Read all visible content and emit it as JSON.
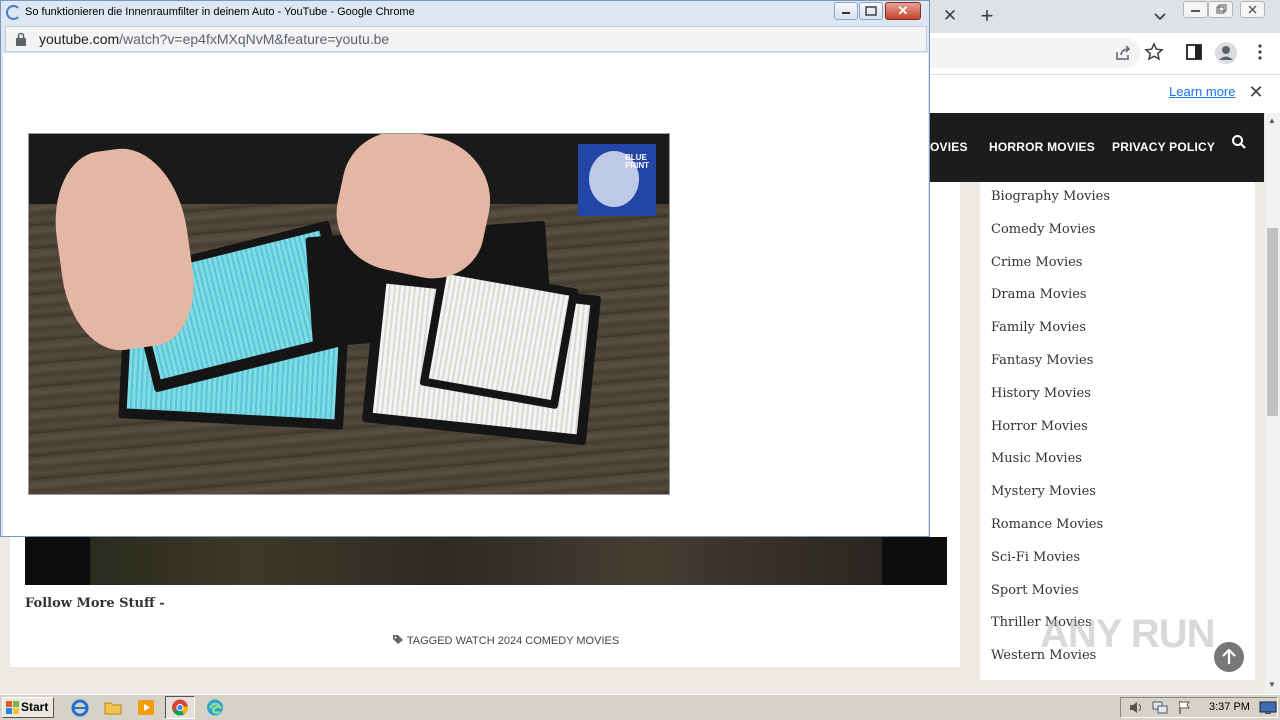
{
  "popup": {
    "title": "So funktionieren die Innenraumfilter in deinem Auto - YouTube - Google Chrome",
    "url_host": "youtube.com",
    "url_path": "/watch?v=ep4fxMXqNvM&feature=youtu.be",
    "video_logo_text": "BLUE PRINT"
  },
  "browser": {
    "infobar_link": "Learn more"
  },
  "site": {
    "nav": [
      "OVIES",
      "HORROR MOVIES",
      "PRIVACY POLICY"
    ],
    "follow_text": "Follow More Stuff -",
    "tagged_prefix": "TAGGED",
    "tagged_link": "WATCH 2024 COMEDY MOVIES",
    "sidebar_categories": [
      "Biography Movies",
      "Comedy Movies",
      "Crime Movies",
      "Drama Movies",
      "Family Movies",
      "Fantasy Movies",
      "History Movies",
      "Horror Movies",
      "Music Movies",
      "Mystery Movies",
      "Romance Movies",
      "Sci-Fi Movies",
      "Sport Movies",
      "Thriller Movies",
      "Western Movies"
    ]
  },
  "watermark": "ANY RUN",
  "taskbar": {
    "start_label": "Start",
    "clock": "3:37 PM",
    "apps": [
      "internet-explorer-icon",
      "file-explorer-icon",
      "media-player-icon",
      "chrome-icon",
      "edge-icon"
    ]
  },
  "colors": {
    "nav_bg": "#1c1c1c",
    "link_blue": "#1a73e8",
    "popup_close": "#c3432b"
  }
}
